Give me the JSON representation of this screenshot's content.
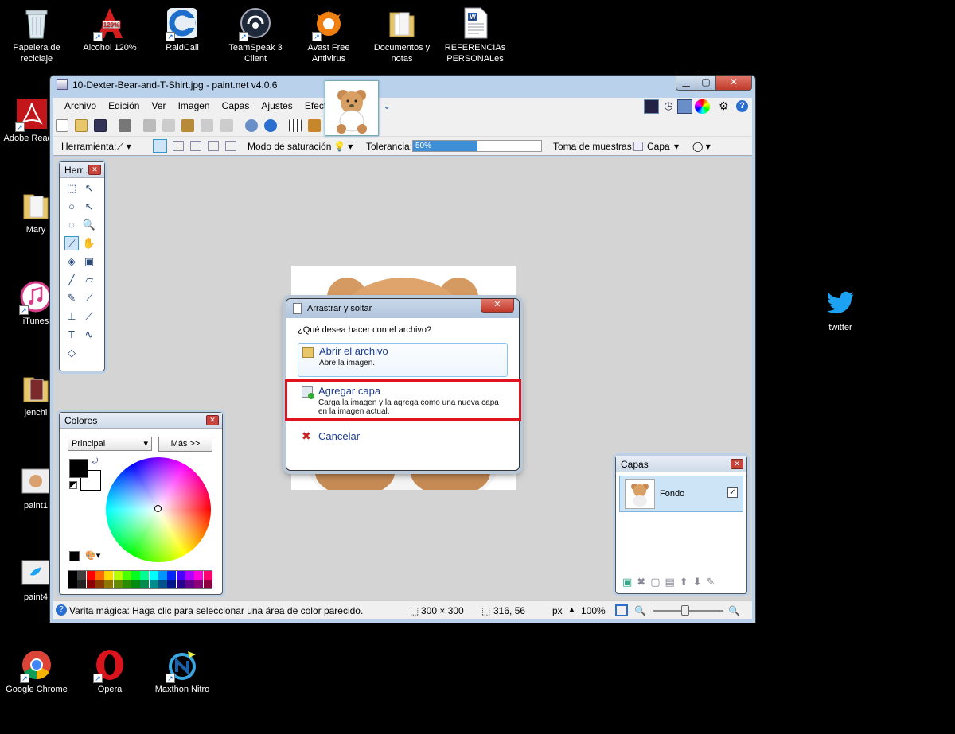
{
  "desktop": {
    "icons_left": [
      {
        "label": "Papelera de reciclaje",
        "name": "recycle-bin-icon"
      },
      {
        "label": "Alcohol 120%",
        "name": "alcohol-icon"
      },
      {
        "label": "RaidCall",
        "name": "raidcall-icon"
      },
      {
        "label": "TeamSpeak 3 Client",
        "name": "teamspeak-icon"
      },
      {
        "label": "Avast Free Antivirus",
        "name": "avast-icon"
      },
      {
        "label": "Documentos y notas",
        "name": "folder-icon"
      },
      {
        "label": "REFERENCIAs PERSONALes",
        "name": "word-document-icon"
      }
    ],
    "icons_side": [
      {
        "label": "Adobe Reader",
        "name": "adobe-reader-icon"
      },
      {
        "label": "Mary",
        "name": "folder-icon"
      },
      {
        "label": "iTunes",
        "name": "itunes-icon"
      },
      {
        "label": "jenchi",
        "name": "folder-icon"
      },
      {
        "label": "paint1",
        "name": "image-file-icon"
      },
      {
        "label": "paint4",
        "name": "image-file-icon"
      }
    ],
    "icons_bottom": [
      {
        "label": "Google Chrome",
        "name": "chrome-icon"
      },
      {
        "label": "Opera",
        "name": "opera-icon"
      },
      {
        "label": "Maxthon Nitro",
        "name": "maxthon-icon"
      }
    ],
    "twitter_label": "twitter"
  },
  "window": {
    "title": "10-Dexter-Bear-and-T-Shirt.jpg - paint.net v4.0.6",
    "menu": [
      "Archivo",
      "Edición",
      "Ver",
      "Imagen",
      "Capas",
      "Ajustes",
      "Efectos"
    ],
    "toolbar2": {
      "tool_label": "Herramienta:",
      "mode_label": "Modo de saturación",
      "tolerance_label": "Tolerancia:",
      "tolerance_value": "50%",
      "tolerance_fraction": 0.5,
      "sampling_label": "Toma de muestras:",
      "sampling_value": "Capa"
    },
    "status": {
      "hint": "Varita mágica: Haga clic para seleccionar una área de color parecido.",
      "size": "300 × 300",
      "pos": "316, 56",
      "unit": "px",
      "zoom": "100%"
    }
  },
  "tools_panel": {
    "title": "Herr..."
  },
  "colors_panel": {
    "title": "Colores",
    "palette_select": "Principal",
    "more_button": "Más >>",
    "primary_color": "#000000",
    "secondary_color": "#ffffff"
  },
  "layers_panel": {
    "title": "Capas",
    "layers": [
      {
        "name": "Fondo",
        "visible": true
      }
    ]
  },
  "dialog": {
    "title": "Arrastrar y soltar",
    "question": "¿Qué desea hacer con el archivo?",
    "open": {
      "title": "Abrir el archivo",
      "desc": "Abre la imagen."
    },
    "add": {
      "title": "Agregar capa",
      "desc": "Carga la imagen y la agrega como una nueva capa en la imagen actual."
    },
    "cancel": "Cancelar",
    "highlight_color": "#e0141e"
  }
}
